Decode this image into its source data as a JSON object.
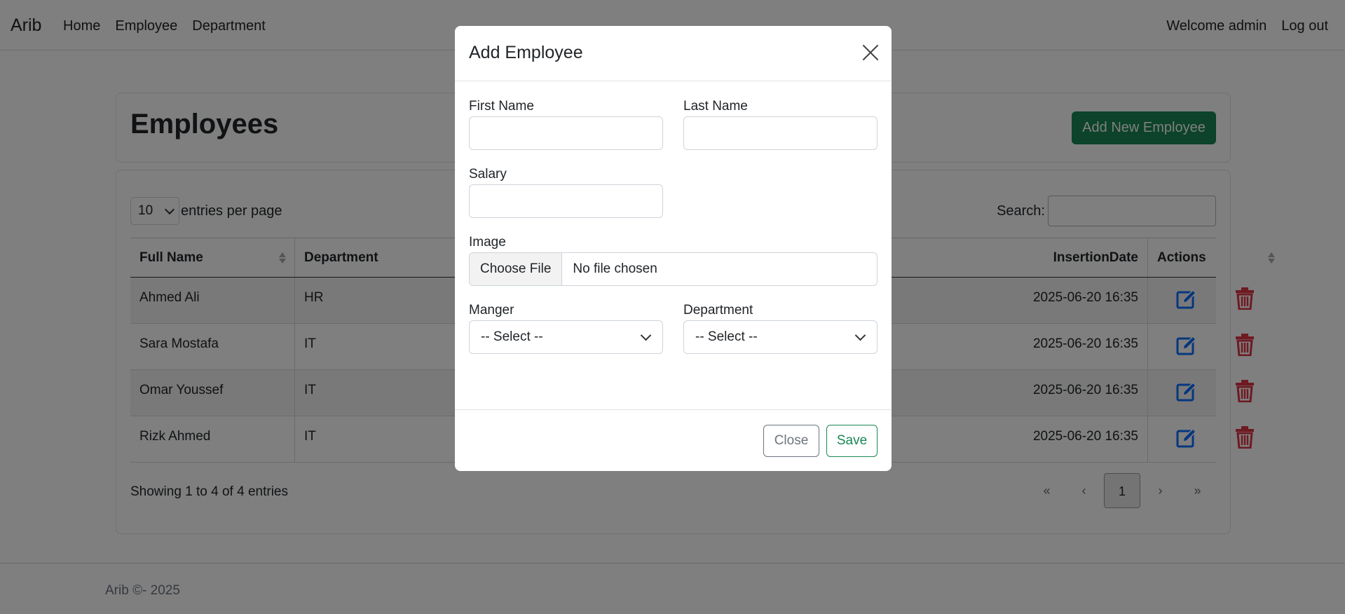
{
  "navbar": {
    "brand": "Arib",
    "links": [
      "Home",
      "Employee",
      "Department"
    ],
    "welcome": "Welcome admin",
    "logout": "Log out"
  },
  "header": {
    "title": "Employees",
    "add_button": "Add New Employee"
  },
  "table_controls": {
    "entries_value": "10",
    "entries_label": "entries per page",
    "search_label": "Search:"
  },
  "table": {
    "headers": {
      "full_name": "Full Name",
      "department": "Department",
      "insertion_date": "InsertionDate",
      "actions": "Actions"
    },
    "rows": [
      {
        "full_name": "Ahmed Ali",
        "department": "HR",
        "insertion_date": "2025-06-20 16:35"
      },
      {
        "full_name": "Sara Mostafa",
        "department": "IT",
        "insertion_date": "2025-06-20 16:35"
      },
      {
        "full_name": "Omar Youssef",
        "department": "IT",
        "insertion_date": "2025-06-20 16:35"
      },
      {
        "full_name": "Rizk Ahmed",
        "department": "IT",
        "insertion_date": "2025-06-20 16:35"
      }
    ]
  },
  "pagination": {
    "info": "Showing 1 to 4 of 4 entries",
    "first": "«",
    "prev": "‹",
    "current": "1",
    "next": "›",
    "last": "»"
  },
  "footer": {
    "text": "Arib ©- 2025"
  },
  "modal": {
    "title": "Add Employee",
    "first_name_label": "First Name",
    "last_name_label": "Last Name",
    "salary_label": "Salary",
    "image_label": "Image",
    "file_button": "Choose File",
    "file_status": "No file chosen",
    "manager_label": "Manger",
    "manager_value": "-- Select --",
    "department_label": "Department",
    "department_value": "-- Select --",
    "close_button": "Close",
    "save_button": "Save"
  },
  "colors": {
    "success": "#198754",
    "primary_icon": "#0d6efd",
    "danger_icon": "#dc3545",
    "secondary": "#6c757d"
  },
  "icons": {
    "edit": "pencil-square-icon",
    "delete": "trash-icon"
  }
}
